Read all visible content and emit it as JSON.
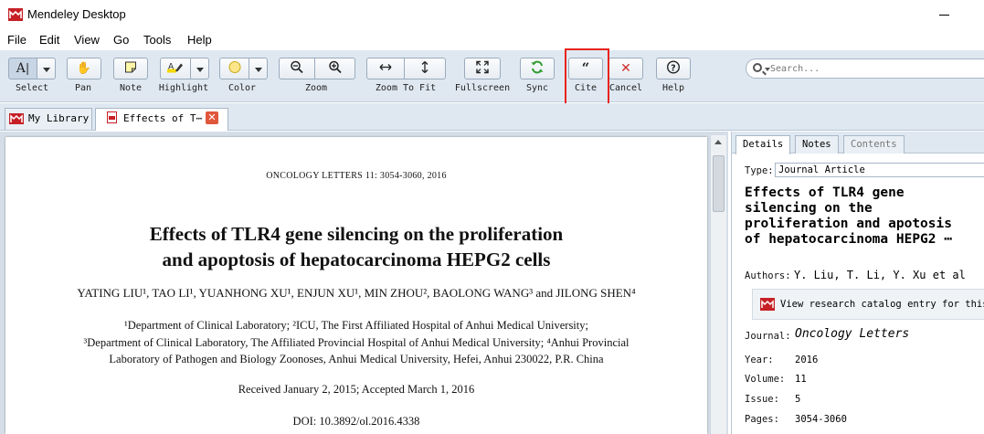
{
  "window": {
    "title": "Mendeley Desktop"
  },
  "menu": [
    "File",
    "Edit",
    "View",
    "Go",
    "Tools",
    "Help"
  ],
  "toolbar": {
    "select": "Select",
    "pan": "Pan",
    "note": "Note",
    "highlight": "Highlight",
    "color": "Color",
    "zoom": "Zoom",
    "zoom_to_fit": "Zoom To Fit",
    "fullscreen": "Fullscreen",
    "sync": "Sync",
    "cite": "Cite",
    "cancel": "Cancel",
    "help": "Help",
    "search_placeholder": "Search...",
    "colors": {
      "sync": "#2e9b2e",
      "cancel": "#d12b2b",
      "highlight_swatch": "#fde68a"
    }
  },
  "tabs": {
    "library": "My Library",
    "document": "Effects of T⋯"
  },
  "pdf": {
    "journal_line": "ONCOLOGY LETTERS  11:  3054-3060,  2016",
    "title_line1": "Effects of TLR4 gene silencing on the proliferation",
    "title_line2": "and apoptosis of hepatocarcinoma HEPG2 cells",
    "authors": "YATING LIU¹,  TAO LI¹,  YUANHONG XU¹,  ENJUN XU¹,  MIN ZHOU²,  BAOLONG WANG³  and  JILONG SHEN⁴",
    "affil1": "¹Department of Clinical Laboratory; ²ICU, The First Affiliated Hospital of Anhui Medical University;",
    "affil2": "³Department of Clinical Laboratory, The Affiliated Provincial Hospital of Anhui Medical University; ⁴Anhui Provincial",
    "affil3": "Laboratory of Pathogen and Biology Zoonoses, Anhui Medical University, Hefei, Anhui 230022, P.R. China",
    "received": "Received January 2, 2015;  Accepted March 1, 2016",
    "doi": "DOI: 10.3892/ol.2016.4338"
  },
  "details": {
    "tabs": [
      "Details",
      "Notes",
      "Contents"
    ],
    "type_label": "Type:",
    "type_value": "Journal Article",
    "title": "Effects of TLR4 gene\nsilencing on the\nproliferation and apotosis\nof hepatocarcinoma HEPG2 ⋯",
    "authors_label": "Authors:",
    "authors_value": "Y. Liu, T. Li, Y. Xu et al",
    "catalog_link": "View research catalog entry for this p",
    "journal_label": "Journal:",
    "journal_value": "Oncology Letters",
    "year_label": "Year:",
    "year_value": "2016",
    "volume_label": "Volume:",
    "volume_value": "11",
    "issue_label": "Issue:",
    "issue_value": "5",
    "pages_label": "Pages:",
    "pages_value": "3054-3060"
  }
}
